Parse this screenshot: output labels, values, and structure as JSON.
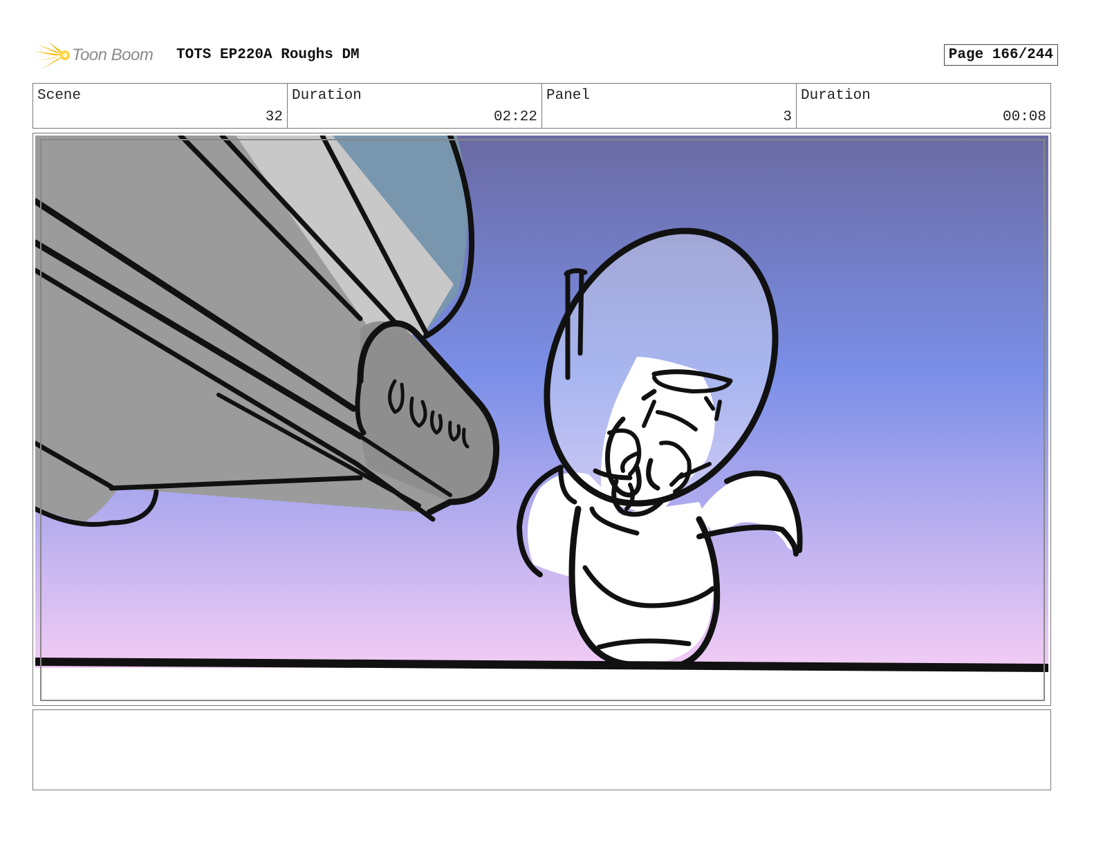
{
  "header": {
    "brand": "Toon Boom",
    "title": "TOTS EP220A Roughs DM",
    "page": "Page 166/244"
  },
  "info": [
    {
      "label": "Scene",
      "value": "32"
    },
    {
      "label": "Duration",
      "value": "02:22"
    },
    {
      "label": "Panel",
      "value": "3"
    },
    {
      "label": "Duration",
      "value": "00:08"
    }
  ],
  "panel": {
    "sky_top_color": "#6a6aa3",
    "sky_mid_color": "#7b8fe8",
    "sky_bottom_color": "#f2ccf5"
  },
  "notes": {
    "text": ""
  }
}
